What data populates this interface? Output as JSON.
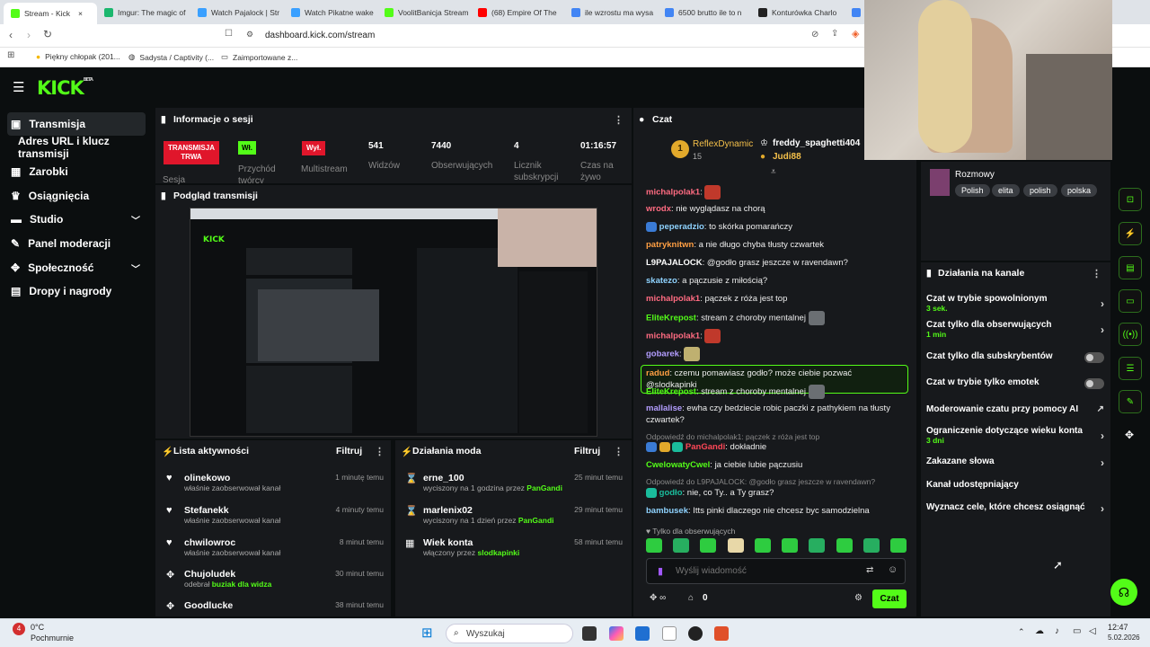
{
  "browser": {
    "tabs": [
      {
        "label": "Stream - Kick",
        "color": "#53fc18"
      },
      {
        "label": "Imgur: The magic of",
        "color": "#1bb76e"
      },
      {
        "label": "Watch Pajalock | Str",
        "color": "#3aa0ff"
      },
      {
        "label": "Watch Pikatne wake",
        "color": "#3aa0ff"
      },
      {
        "label": "VoolitBanicja Stream",
        "color": "#53fc18"
      },
      {
        "label": "(68) Empire Of The",
        "color": "#ff0000"
      },
      {
        "label": "ile wzrostu ma wysa",
        "color": "#4285f4"
      },
      {
        "label": "6500 brutto ile to n",
        "color": "#4285f4"
      },
      {
        "label": "Konturówka Charlo",
        "color": "#222222"
      },
      {
        "label": "...",
        "color": "#4285f4"
      }
    ],
    "url": "dashboard.kick.com/stream",
    "bookmarks": [
      "Piękny chłopak (201...",
      "Sadysta / Captivity (...",
      "Zaimportowane z..."
    ]
  },
  "nav": {
    "items": [
      {
        "label": "Transmisja",
        "icon": "broadcast-icon",
        "active": true
      },
      {
        "label": "Adres URL i klucz transmisji",
        "icon": "",
        "active": false
      },
      {
        "label": "Zarobki",
        "icon": "earnings-icon"
      },
      {
        "label": "Osiągnięcia",
        "icon": "trophy-icon"
      },
      {
        "label": "Studio",
        "icon": "studio-icon"
      },
      {
        "label": "Panel moderacji",
        "icon": "wrench-icon"
      },
      {
        "label": "Społeczność",
        "icon": "community-icon"
      },
      {
        "label": "Dropy i nagrody",
        "icon": "drops-icon"
      }
    ]
  },
  "session": {
    "title": "Informacje o sesji",
    "live_badge": "TRANSMISJA TRWA",
    "session_label": "Sesja",
    "toggles": [
      {
        "state": "Wł.",
        "label": "Przychód twórcy"
      },
      {
        "state": "Wył.",
        "label": "Multistream"
      }
    ],
    "stats": [
      {
        "value": "541",
        "label": "Widzów"
      },
      {
        "value": "7440",
        "label": "Obserwujących"
      },
      {
        "value": "4",
        "label": "Licznik subskrypcji"
      },
      {
        "value": "01:16:57",
        "label": "Czas na żywo"
      }
    ]
  },
  "preview": {
    "title": "Podgląd transmisji"
  },
  "activity": {
    "title": "Lista aktywności",
    "filter": "Filtruj",
    "items": [
      {
        "name": "olinekowo",
        "desc": "właśnie zaobserwował kanał",
        "time": "1 minutę temu",
        "icon": "heart-icon"
      },
      {
        "name": "Stefanekk",
        "desc": "właśnie zaobserwował kanał",
        "time": "4 minuty temu",
        "icon": "heart-icon"
      },
      {
        "name": "chwilowroc",
        "desc": "właśnie zaobserwował kanał",
        "time": "8 minut temu",
        "icon": "heart-icon"
      },
      {
        "name": "Chujoludek",
        "desc": "odebrał",
        "extra": "buziak dla widza",
        "time": "30 minut temu",
        "icon": "drops-icon"
      },
      {
        "name": "Goodlucke",
        "desc": "",
        "time": "38 minut temu",
        "icon": "drops-icon"
      }
    ]
  },
  "modactions": {
    "title": "Działania moda",
    "filter": "Filtruj",
    "items": [
      {
        "name": "erne_100",
        "desc": "wyciszony na 1 godzina przez",
        "by": "PanGandi",
        "time": "25 minut temu",
        "icon": "hourglass-icon"
      },
      {
        "name": "marlenix02",
        "desc": "wyciszony na 1 dzień przez",
        "by": "PanGandi",
        "time": "29 minut temu",
        "icon": "hourglass-icon"
      },
      {
        "name": "Wiek konta",
        "desc": "włączony przez",
        "by": "slodkapinki",
        "time": "58 minut temu",
        "icon": "calendar-icon"
      }
    ]
  },
  "chat": {
    "title": "Czat",
    "pinned": {
      "rank": "1",
      "name": "ReflexDynamic",
      "count": "15",
      "name2": "freddy_spaghetti404",
      "name3": "Judi88"
    },
    "messages": [
      {
        "user": "michalpolak1",
        "color": "#ff6b81",
        "text": "",
        "emote": "red"
      },
      {
        "user": "wrodx",
        "color": "#ff6b81",
        "text": "nie wyglądasz na chorą"
      },
      {
        "user": "peperadzio",
        "color": "#8fd3ff",
        "text": "to skórka pomarańczy",
        "badge": true
      },
      {
        "user": "patryknitwn",
        "color": "#ff9f43",
        "text": "a nie długo chyba tłusty czwartek"
      },
      {
        "user": "L9PAJALOCK",
        "color": "#ffffff",
        "text": "@godło grasz jeszcze w ravendawn?"
      },
      {
        "user": "skatezo",
        "color": "#8fd3ff",
        "text": "a pączusie z miłością?"
      },
      {
        "user": "michalpolak1",
        "color": "#ff6b81",
        "text": "pączek z róża jest top"
      },
      {
        "user": "EliteKrepost",
        "color": "#53fc18",
        "text": "stream z choroby mentalnej",
        "emote": "face"
      },
      {
        "user": "michalpolak1",
        "color": "#ff6b81",
        "text": "",
        "emote": "red"
      },
      {
        "user": "gobarek",
        "color": "#b39dff",
        "text": "",
        "emote": "cat"
      },
      {
        "user": "radud",
        "color": "#ff9f43",
        "text": "czemu pomawiasz godło? może ciebie pozwać @slodkapinki",
        "highlight": true
      },
      {
        "user": "EliteKrepost",
        "color": "#53fc18",
        "text": "stream z choroby mentalnej",
        "emote": "face"
      },
      {
        "user": "mallalise",
        "color": "#b39dff",
        "text": "ewha czy bedziecie robic paczki z pathykiem na tłusty czwartek?"
      }
    ],
    "reply1": "Odpowiedź do michalpolak1: pączek z róża jest top",
    "reply1_user": "PanGandi",
    "reply1_text": "dokładnie",
    "msg_cwel": {
      "user": "CwelowatyCwel",
      "text": "ja ciebie lubie pączusiu"
    },
    "reply2": "Odpowiedź do L9PAJALOCK: @godło grasz jeszcze w ravendawn?",
    "reply2_user": "godło",
    "reply2_text": "nie, co Ty.. a Ty grasz?",
    "msg_last": {
      "user": "bambusek",
      "text": "Itts pinki dlaczego nie chcesz byc samodzielna"
    },
    "followers_only": "Tylko dla obserwujących",
    "input_placeholder": "Wyślij wiadomość",
    "viewers": "0",
    "send": "Czat"
  },
  "category": {
    "name": "Rozmowy",
    "tags": [
      "Polish",
      "elita",
      "polish",
      "polska"
    ]
  },
  "channel_actions": {
    "title": "Działania na kanale",
    "items": [
      {
        "label": "Czat w trybie spowolnionym",
        "sub": "3 sek.",
        "ctrl": "chevron"
      },
      {
        "label": "Czat tylko dla obserwujących",
        "sub": "1 min",
        "ctrl": "chevron"
      },
      {
        "label": "Czat tylko dla subskrybentów",
        "sub": "",
        "ctrl": "toggle"
      },
      {
        "label": "Czat w trybie tylko emotek",
        "sub": "",
        "ctrl": "toggle"
      },
      {
        "label": "Moderowanie czatu przy pomocy AI",
        "sub": "",
        "ctrl": "external"
      },
      {
        "label": "Ograniczenie dotyczące wieku konta",
        "sub": "3 dni",
        "ctrl": "chevron"
      },
      {
        "label": "Zakazane słowa",
        "sub": "",
        "ctrl": "chevron"
      },
      {
        "label": "Kanał udostępniający",
        "sub": "",
        "ctrl": "none"
      },
      {
        "label": "Wyznacz cele, które chcesz osiągnąć",
        "sub": "",
        "ctrl": "chevron"
      }
    ]
  },
  "taskbar": {
    "temp": "0°C",
    "weather": "Pochmurnie",
    "search": "Wyszukaj",
    "time": "12:47",
    "date": "5.02.2026",
    "notif": "4"
  }
}
